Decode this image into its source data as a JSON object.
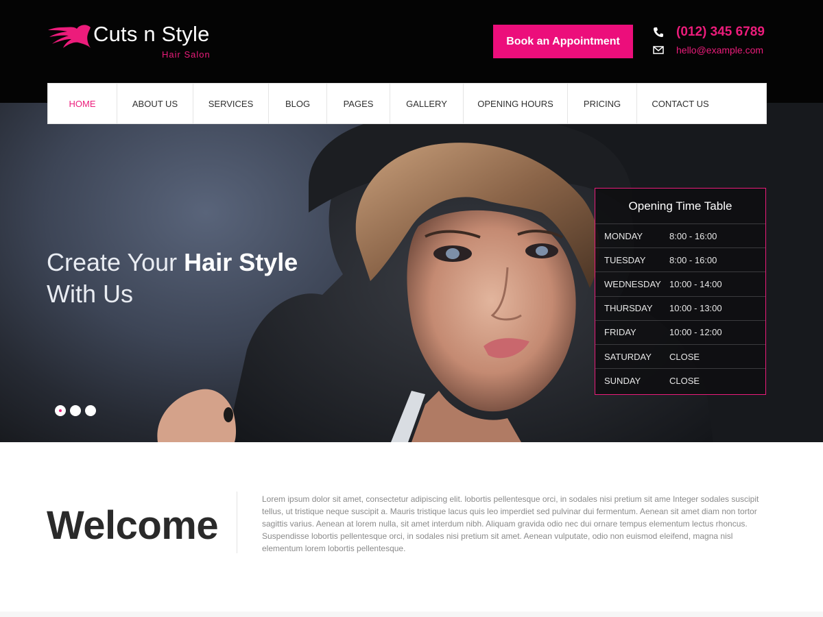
{
  "brand": {
    "name": "Cuts n Style",
    "tagline": "Hair Salon",
    "accent": "#ec1c7b"
  },
  "header": {
    "book_button": "Book an Appointment",
    "phone": "(012) 345 6789",
    "email": "hello@example.com",
    "phone_icon": "phone-icon",
    "email_icon": "envelope-icon"
  },
  "nav": {
    "items": [
      "HOME",
      "ABOUT US",
      "SERVICES",
      "BLOG",
      "PAGES",
      "GALLERY",
      "OPENING HOURS",
      "PRICING",
      "CONTACT US"
    ],
    "active": "HOME"
  },
  "hero": {
    "headline_light": "Create Your",
    "headline_bold": "Hair Style",
    "headline_line2": "With Us",
    "slides": 3,
    "active_slide": 1
  },
  "timetable": {
    "title": "Opening Time Table",
    "rows": [
      {
        "day": "MONDAY",
        "time": "8:00 - 16:00"
      },
      {
        "day": "TUESDAY",
        "time": "8:00 - 16:00"
      },
      {
        "day": "WEDNESDAY",
        "time": "10:00 - 14:00"
      },
      {
        "day": "THURSDAY",
        "time": "10:00 - 13:00"
      },
      {
        "day": "FRIDAY",
        "time": "10:00 - 12:00"
      },
      {
        "day": "SATURDAY",
        "time": "CLOSE"
      },
      {
        "day": "SUNDAY",
        "time": "CLOSE"
      }
    ]
  },
  "welcome": {
    "title": "Welcome",
    "body": "Lorem ipsum dolor sit amet, consectetur adipiscing elit. lobortis pellentesque orci, in sodales nisi pretium sit ame Integer sodales suscipit tellus, ut tristique neque suscipit a. Mauris tristique lacus quis leo imperdiet sed pulvinar dui fermentum. Aenean sit amet diam non tortor sagittis varius. Aenean at lorem nulla, sit amet interdum nibh. Aliquam gravida odio nec dui ornare tempus elementum lectus rhoncus. Suspendisse lobortis pellentesque orci, in sodales nisi pretium sit amet. Aenean vulputate, odio non euismod eleifend, magna nisl elementum lorem lobortis pellentesque."
  }
}
